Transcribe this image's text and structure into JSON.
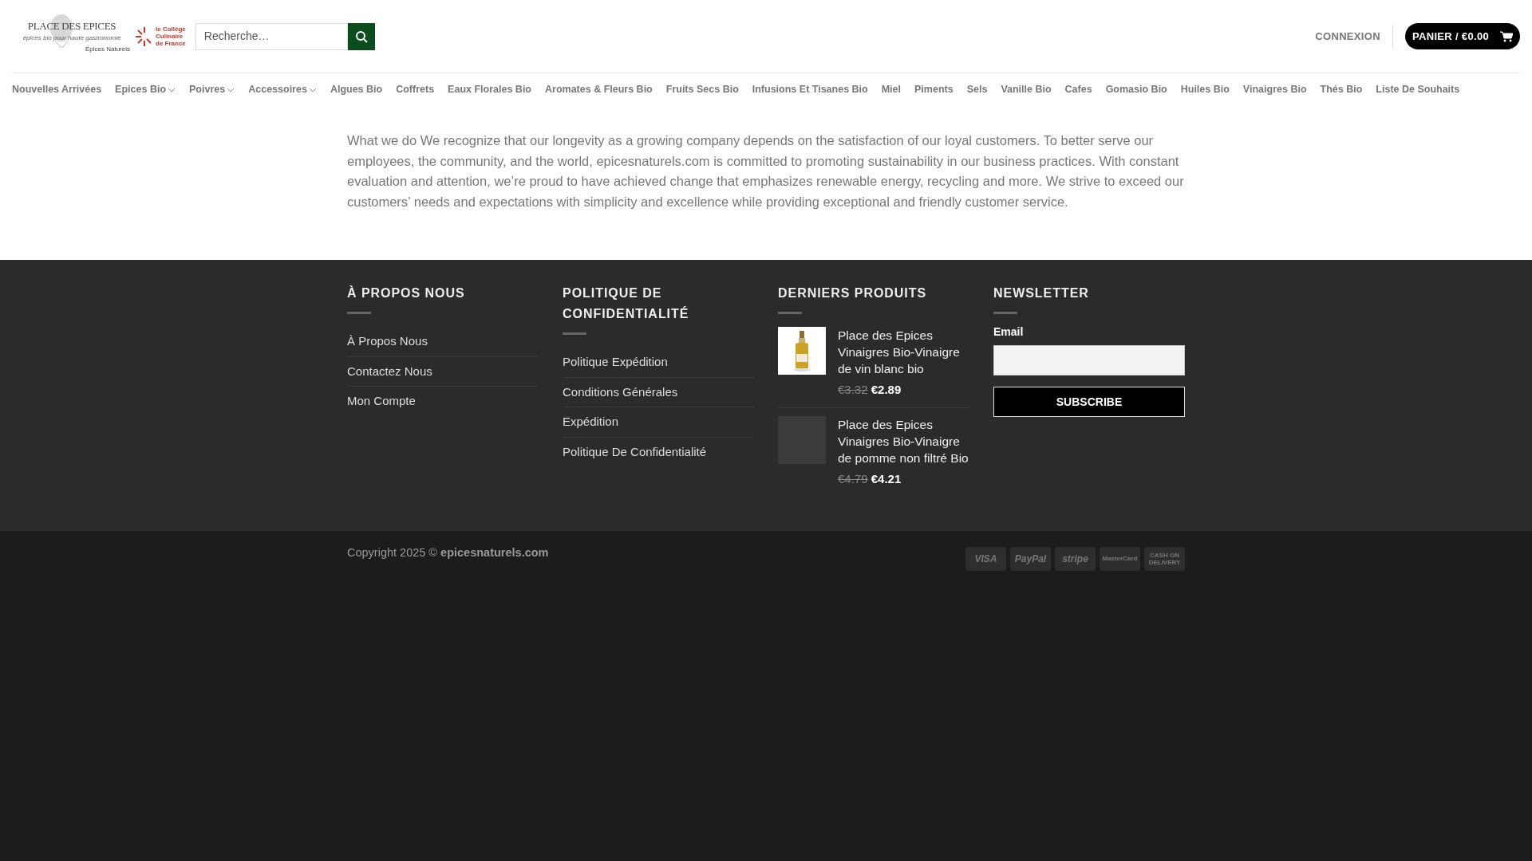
{
  "header": {
    "logo": {
      "title": "PLACE DES EPICES",
      "tagline": "épices bio pour haute gastronomie",
      "subtitle": "Épices Naturels"
    },
    "partner_logo": [
      "le Collège",
      "Culinaire",
      "de France"
    ],
    "search": {
      "placeholder": "Recherche…"
    },
    "login": "CONNEXION",
    "cart": "PANIER / €0.00"
  },
  "nav": [
    {
      "label": "Nouvelles Arrivées",
      "dropdown": false
    },
    {
      "label": "Epices Bio",
      "dropdown": true
    },
    {
      "label": "Poivres",
      "dropdown": true
    },
    {
      "label": "Accessoires",
      "dropdown": true
    },
    {
      "label": "Algues Bio",
      "dropdown": false
    },
    {
      "label": "Coffrets",
      "dropdown": false
    },
    {
      "label": "Eaux Florales Bio",
      "dropdown": false
    },
    {
      "label": "Aromates & Fleurs Bio",
      "dropdown": false
    },
    {
      "label": "Fruits Secs Bio",
      "dropdown": false
    },
    {
      "label": "Infusions Et Tisanes Bio",
      "dropdown": false
    },
    {
      "label": "Miel",
      "dropdown": false
    },
    {
      "label": "Piments",
      "dropdown": false
    },
    {
      "label": "Sels",
      "dropdown": false
    },
    {
      "label": "Vanille Bio",
      "dropdown": false
    },
    {
      "label": "Cafes",
      "dropdown": false
    },
    {
      "label": "Gomasio Bio",
      "dropdown": false
    },
    {
      "label": "Huiles Bio",
      "dropdown": false
    },
    {
      "label": "Vinaigres Bio",
      "dropdown": false
    },
    {
      "label": "Thés Bio",
      "dropdown": false
    },
    {
      "label": "Liste De Souhaits",
      "dropdown": false
    }
  ],
  "content": "What we do We recognize that our longevity as a growing company depends on the satisfaction of our loyal customers. To better serve our employees, the community, and the world, epicesnaturels.com is committed to promoting sustainability in our business practices. With constant evaluation and attention, we’re proud to have achieved change that emphasizes renewable energy, recycling and more. We strive to exceed our customers’ needs and expectations with simplicity and excellence while providing exceptional and friendly customer service.",
  "footer": {
    "about": {
      "title": "À PROPOS NOUS",
      "links": [
        "À Propos Nous",
        "Contactez Nous",
        "Mon Compte"
      ]
    },
    "policy": {
      "title": "POLITIQUE DE CONFIDENTIALITÉ",
      "links": [
        "Politique Expédition",
        "Conditions Générales",
        "Expédition",
        "Politique De Confidentialité"
      ]
    },
    "products": {
      "title": "DERNIERS PRODUITS",
      "items": [
        {
          "name": "Place des Epices Vinaigres Bio-Vinaigre de vin blanc bio",
          "old_price": "€3.32",
          "price": "€2.89",
          "kind": "picture"
        },
        {
          "name": "Place des Epices Vinaigres Bio-Vinaigre de pomme non filtré Bio",
          "old_price": "€4.79",
          "price": "€4.21",
          "kind": "placeholder"
        }
      ]
    },
    "newsletter": {
      "title": "NEWSLETTER",
      "email_label": "Email",
      "button": "SUBSCRIBE"
    }
  },
  "bottom_bar": {
    "copyright": "Copyright 2025 © **epicesnaturels.com**",
    "payment_icons": [
      "VISA",
      "PayPal",
      "stripe",
      "MasterCard",
      "CASH ON DELIVERY"
    ]
  }
}
